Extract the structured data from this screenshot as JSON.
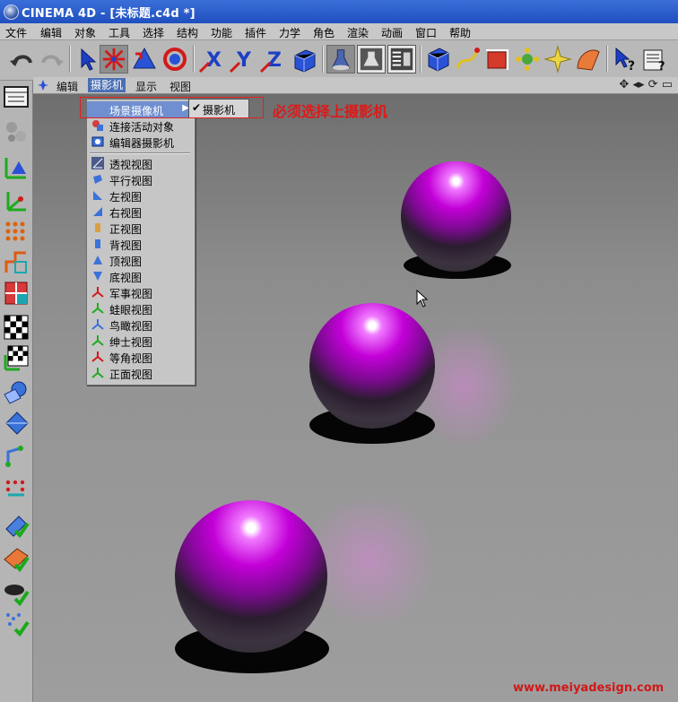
{
  "window": {
    "title": "CINEMA 4D - [未标题.c4d *]"
  },
  "menu": [
    "文件",
    "编辑",
    "对象",
    "工具",
    "选择",
    "结构",
    "功能",
    "插件",
    "力学",
    "角色",
    "渲染",
    "动画",
    "窗口",
    "帮助"
  ],
  "viewport_menu": {
    "items": [
      "编辑",
      "摄影机",
      "显示",
      "视图"
    ],
    "active_index": 1
  },
  "camera_menu": {
    "items": [
      {
        "label": "场景摄像机",
        "icon": "scene-camera-icon",
        "has_submenu": true,
        "highlighted": true
      },
      {
        "label": "连接活动对象",
        "icon": "link-object-icon"
      },
      {
        "label": "编辑器摄影机",
        "icon": "editor-camera-icon"
      },
      {
        "label": "透视视图",
        "icon": "perspective-view-icon"
      },
      {
        "label": "平行视图",
        "icon": "parallel-view-icon"
      },
      {
        "label": "左视图",
        "icon": "left-view-icon"
      },
      {
        "label": "右视图",
        "icon": "right-view-icon"
      },
      {
        "label": "正视图",
        "icon": "front-view-icon"
      },
      {
        "label": "背视图",
        "icon": "back-view-icon"
      },
      {
        "label": "顶视图",
        "icon": "top-view-icon"
      },
      {
        "label": "底视图",
        "icon": "bottom-view-icon"
      },
      {
        "label": "军事视图",
        "icon": "military-view-icon"
      },
      {
        "label": "蛙眼视图",
        "icon": "frog-view-icon"
      },
      {
        "label": "鸟瞰视图",
        "icon": "bird-view-icon"
      },
      {
        "label": "绅士视图",
        "icon": "gentleman-view-icon"
      },
      {
        "label": "等角视图",
        "icon": "isometric-view-icon"
      },
      {
        "label": "正面视图",
        "icon": "dimetric-view-icon"
      }
    ]
  },
  "submenu": {
    "label": "摄影机",
    "checked": true
  },
  "annotation": "必须选择上摄影机",
  "watermark": "www.meiyadesign.com",
  "colors": {
    "title_bar": "#2a5bd0",
    "menu_highlight": "#6f8fd0",
    "annotation_red": "#e01818",
    "sphere_magenta": "#c300d8"
  }
}
